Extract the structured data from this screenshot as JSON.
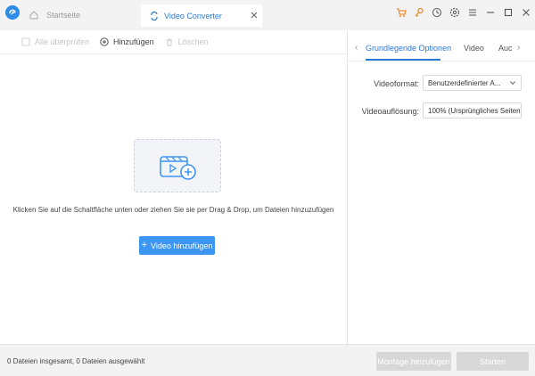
{
  "titlebar": {
    "tab_home": "Startseite",
    "tab_active": "Video Converter"
  },
  "toolbar": {
    "select_all": "Alle überprüfen",
    "add": "Hinzufügen",
    "delete": "Löschen"
  },
  "main": {
    "hint": "Klicken Sie auf die Schaltfläche unten oder ziehen Sie sie per Drag & Drop, um Dateien hinzuzufügen",
    "add_video_button": "Video hinzufügen"
  },
  "options": {
    "tabs": [
      "Grundlegende Optionen",
      "Video",
      "Auc"
    ],
    "videoformat_label": "Videoformat:",
    "videoformat_value": "Benutzerdefinierter A...",
    "resolution_label": "Videoauflösung:",
    "resolution_value": "100% (Ursprüngliches Seiten"
  },
  "statusbar": {
    "summary": "0 Dateien insgesamt, 0 Dateien ausgewählt",
    "montage_button": "Montage hinzufügen",
    "start_button": "Starten"
  },
  "icons": {
    "cart": "cart-icon",
    "key": "key-icon",
    "history": "clock-icon",
    "settings": "gear-icon",
    "menu": "menu-icon",
    "minimize": "minimize-icon",
    "maximize": "maximize-icon",
    "close": "close-icon"
  },
  "colors": {
    "accent": "#2a78d6",
    "button_primary": "#3e96f3",
    "orange_icons": "#f08a24",
    "disabled_button": "#d8d8d8"
  }
}
